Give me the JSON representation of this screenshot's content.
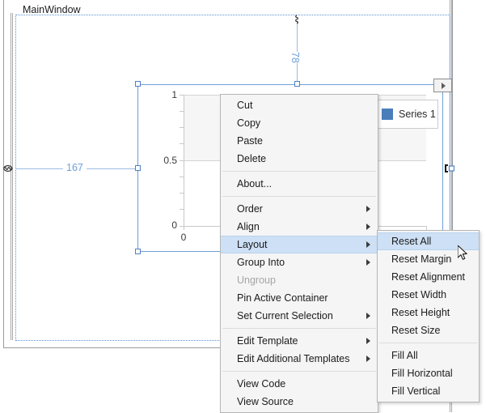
{
  "designer": {
    "window_title": "MainWindow",
    "margin_top_value": "78",
    "margin_left_value": "167",
    "link_icon_left": "chain-link-icon",
    "link_icon_right": "chain-link-icon",
    "smart_tag_icon": "triangle-right-icon"
  },
  "chart": {
    "legend_label": "Series 1",
    "legend_color": "#4a7ebb"
  },
  "chart_data": {
    "type": "line",
    "title": "",
    "xlabel": "",
    "ylabel": "",
    "series": [
      {
        "name": "Series 1",
        "color": "#4a7ebb",
        "values": []
      }
    ],
    "legend": [
      "Series 1"
    ],
    "legend_position": "top-right",
    "grid": true,
    "yticks": [
      "0",
      "0.5",
      "1"
    ],
    "ylim": [
      0,
      1
    ],
    "xticks": [
      "0"
    ],
    "xlim": [
      0,
      1
    ]
  },
  "context_menu": {
    "items": [
      {
        "label": "Cut",
        "type": "item"
      },
      {
        "label": "Copy",
        "type": "item"
      },
      {
        "label": "Paste",
        "type": "item"
      },
      {
        "label": "Delete",
        "type": "item"
      },
      {
        "label": "",
        "type": "separator"
      },
      {
        "label": "About...",
        "type": "item"
      },
      {
        "label": "",
        "type": "separator"
      },
      {
        "label": "Order",
        "type": "submenu"
      },
      {
        "label": "Align",
        "type": "submenu"
      },
      {
        "label": "Layout",
        "type": "submenu",
        "state": "highlight"
      },
      {
        "label": "Group Into",
        "type": "submenu"
      },
      {
        "label": "Ungroup",
        "type": "item",
        "state": "disabled"
      },
      {
        "label": "Pin Active Container",
        "type": "item"
      },
      {
        "label": "Set Current Selection",
        "type": "submenu"
      },
      {
        "label": "",
        "type": "separator"
      },
      {
        "label": "Edit Template",
        "type": "submenu"
      },
      {
        "label": "Edit Additional Templates",
        "type": "submenu"
      },
      {
        "label": "",
        "type": "separator"
      },
      {
        "label": "View Code",
        "type": "item"
      },
      {
        "label": "View Source",
        "type": "item"
      }
    ]
  },
  "layout_submenu": {
    "items": [
      {
        "label": "Reset All",
        "type": "item",
        "state": "highlight"
      },
      {
        "label": "Reset Margin",
        "type": "item"
      },
      {
        "label": "Reset Alignment",
        "type": "item"
      },
      {
        "label": "Reset Width",
        "type": "item"
      },
      {
        "label": "Reset Height",
        "type": "item"
      },
      {
        "label": "Reset Size",
        "type": "item"
      },
      {
        "label": "",
        "type": "separator"
      },
      {
        "label": "Fill All",
        "type": "item"
      },
      {
        "label": "Fill Horizontal",
        "type": "item"
      },
      {
        "label": "Fill Vertical",
        "type": "item"
      }
    ]
  }
}
